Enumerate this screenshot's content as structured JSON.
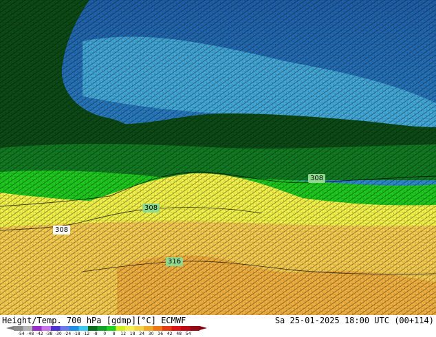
{
  "title": {
    "left": "Height/Temp. 700 hPa [gdmp][°C] ECMWF",
    "right": "Sa 25-01-2025 18:00 UTC (00+114)"
  },
  "contour_labels": [
    {
      "text": "308",
      "bg": "#8fd98f"
    },
    {
      "text": "308",
      "bg": "#8fd98f"
    },
    {
      "text": "308",
      "bg": "#ffffff"
    },
    {
      "text": "316",
      "bg": "#8fd98f"
    }
  ],
  "colorbar": {
    "ticks": [
      "-54",
      "-48",
      "-42",
      "-38",
      "-30",
      "-24",
      "-18",
      "-12",
      "-8",
      "0",
      "8",
      "12",
      "18",
      "24",
      "30",
      "36",
      "42",
      "48",
      "54"
    ],
    "colors": [
      "#8c8c8c",
      "#b4b4b4",
      "#9a2fc8",
      "#c873e6",
      "#4b32d2",
      "#6a7ae8",
      "#1e8fe6",
      "#3cc8f0",
      "#0a6e1e",
      "#12a028",
      "#1ed21e",
      "#d2f01e",
      "#f5f050",
      "#f5d246",
      "#f0aa28",
      "#f07814",
      "#e63c14",
      "#dc1414",
      "#be0a14",
      "#960a14"
    ],
    "arrow_left_color": "#7a7a7a",
    "arrow_right_color": "#7d0010"
  },
  "palette": {
    "deep_blue": "#1f5fa8",
    "mid_blue": "#2c86c8",
    "light_blue": "#4cb8e0",
    "dark_green": "#0c4a16",
    "green": "#127a22",
    "bright_green": "#1fc81f",
    "yellow": "#f2f24a",
    "light_orange": "#f5cc50",
    "orange": "#f0b040"
  }
}
